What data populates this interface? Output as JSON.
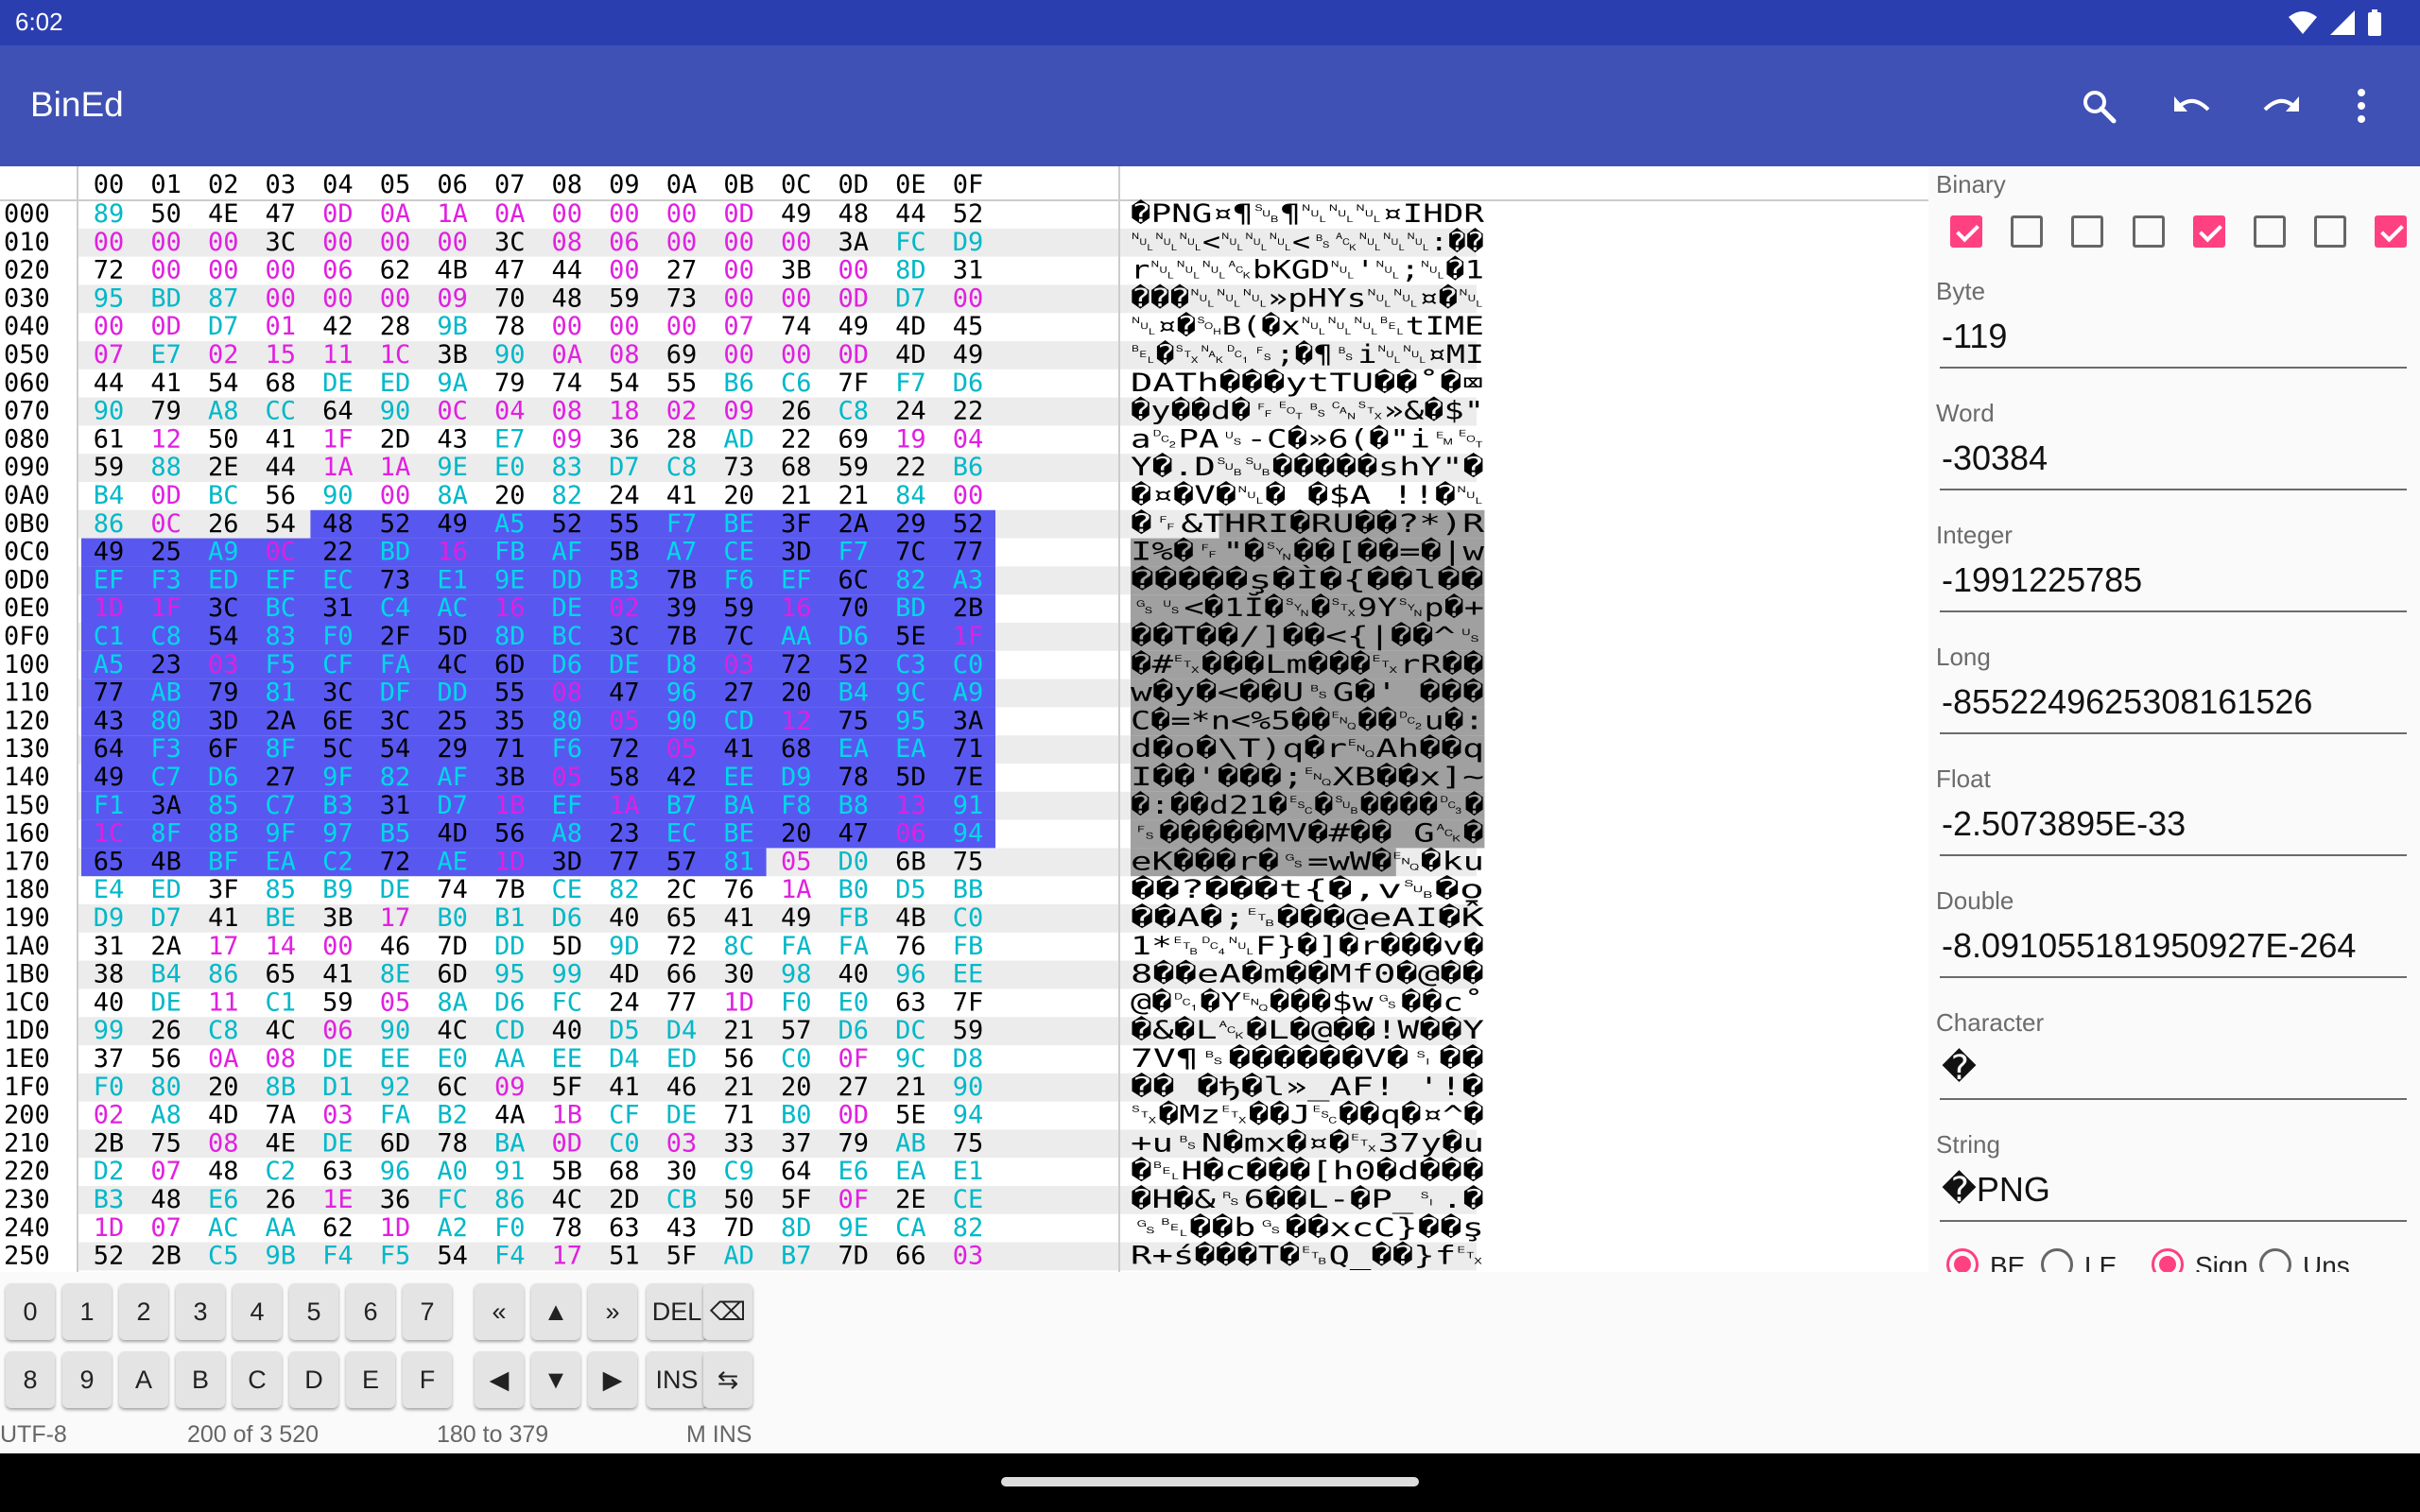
{
  "status_bar": {
    "time": "6:02"
  },
  "app_bar": {
    "title": "BinEd",
    "actions": [
      "search-icon",
      "undo-icon",
      "redo-icon",
      "more-vert-icon"
    ]
  },
  "hex_view": {
    "column_header": [
      "00",
      "01",
      "02",
      "03",
      "04",
      "05",
      "06",
      "07",
      "08",
      "09",
      "0A",
      "0B",
      "0C",
      "0D",
      "0E",
      "0F"
    ],
    "rows": [
      {
        "addr": "000",
        "hex": "89 50 4E 47 0D 0A 1A 0A 00 00 00 0D 49 48 44 52",
        "text": "�PNG¤¶␚¶␀␀␀¤IHDR"
      },
      {
        "addr": "010",
        "hex": "00 00 00 3C 00 00 00 3C 08 06 00 00 00 3A FC D9",
        "text": "␀␀␀<␀␀␀<␈␆␀␀␀:��"
      },
      {
        "addr": "020",
        "hex": "72 00 00 00 06 62 4B 47 44 00 27 00 3B 00 8D 31",
        "text": "r␀␀␀␆bKGD␀'␀;␀�1"
      },
      {
        "addr": "030",
        "hex": "95 BD 87 00 00 00 09 70 48 59 73 00 00 0D D7 00",
        "text": "���␀␀␀»pHYs␀␀¤�␀"
      },
      {
        "addr": "040",
        "hex": "00 0D D7 01 42 28 9B 78 00 00 00 07 74 49 4D 45",
        "text": "␀¤�␁B(�x␀␀␀␇tIME"
      },
      {
        "addr": "050",
        "hex": "07 E7 02 15 11 1C 3B 90 0A 08 69 00 00 0D 4D 49",
        "text": "␇�␂␕␑␜;�¶␈i␀␀¤MI"
      },
      {
        "addr": "060",
        "hex": "44 41 54 68 DE ED 9A 79 74 54 55 B6 C6 7F F7 D6",
        "text": "DATh���ytTU��˚�⌧"
      },
      {
        "addr": "070",
        "hex": "90 79 A8 CC 64 90 0C 04 08 18 02 09 26 C8 24 22",
        "text": "�y��d�␌␄␈␘␂»&�$\""
      },
      {
        "addr": "080",
        "hex": "61 12 50 41 1F 2D 43 E7 09 36 28 AD 22 69 19 04",
        "text": "a␒PA␟-C�»6(�\"i␙␄"
      },
      {
        "addr": "090",
        "hex": "59 88 2E 44 1A 1A 9E E0 83 D7 C8 73 68 59 22 B6",
        "text": "Y�.D␚␚�����shY\"�"
      },
      {
        "addr": "0A0",
        "hex": "B4 0D BC 56 90 00 8A 20 82 24 41 20 21 21 84 00",
        "text": "�¤�V�␀� �$A !!�␀"
      },
      {
        "addr": "0B0",
        "hex": "86 0C 26 54 48 52 49 A5 52 55 F7 BE 3F 2A 29 52",
        "text": "�␌&THRI�RU��?*)R"
      },
      {
        "addr": "0C0",
        "hex": "49 25 A9 0C 22 BD 16 FB AF 5B A7 CE 3D F7 7C 77",
        "text": "I%�␌\"�␖��[��=�|w"
      },
      {
        "addr": "0D0",
        "hex": "EF F3 ED EF EC 73 E1 9E DD B3 7B F6 EF 6C 82 A3",
        "text": "�����ş�Ì�{��l��"
      },
      {
        "addr": "0E0",
        "hex": "1D 1F 3C BC 31 C4 AC 16 DE 02 39 59 16 70 BD 2B",
        "text": "␝␟<�1Ĭ�␖�␂9Y␖p�+"
      },
      {
        "addr": "0F0",
        "hex": "C1 C8 54 83 F0 2F 5D 8D BC 3C 7B 7C AA D6 5E 1F",
        "text": "��T��/]��<{|��^␟"
      },
      {
        "addr": "100",
        "hex": "A5 23 03 F5 CF FA 4C 6D D6 DE D8 03 72 52 C3 C0",
        "text": "�#␃���Lm���␃rR��"
      },
      {
        "addr": "110",
        "hex": "77 AB 79 81 3C DF DD 55 08 47 96 27 20 B4 9C A9",
        "text": "w�y�<��U␈G�' ���"
      },
      {
        "addr": "120",
        "hex": "43 80 3D 2A 6E 3C 25 35 80 05 90 CD 12 75 95 3A",
        "text": "C�=*n<%5��␅��␒u�:"
      },
      {
        "addr": "130",
        "hex": "64 F3 6F 8F 5C 54 29 71 F6 72 05 41 68 EA EA 71",
        "text": "d�o�\\T)q�r␅Ah��q"
      },
      {
        "addr": "140",
        "hex": "49 C7 D6 27 9F 82 AF 3B 05 58 42 EE D9 78 5D 7E",
        "text": "I��'���;␅XB��x]~"
      },
      {
        "addr": "150",
        "hex": "F1 3A 85 C7 B3 31 D7 1B EF 1A B7 BA F8 B8 13 91",
        "text": "�:��d21�␛�␚����␓�"
      },
      {
        "addr": "160",
        "hex": "1C 8F 8B 9F 97 B5 4D 56 A8 23 EC BE 20 47 06 94",
        "text": "␜�����MV�#�� G␆�"
      },
      {
        "addr": "170",
        "hex": "65 4B BF EA C2 72 AE 1D 3D 77 57 81 05 D0 6B 75",
        "text": "eK���r�␝=wW�␅�ku"
      },
      {
        "addr": "180",
        "hex": "E4 ED 3F 85 B9 DE 74 7B CE 82 2C 76 1A B0 D5 BB",
        "text": "��?���t{�,v␚�o̱"
      },
      {
        "addr": "190",
        "hex": "D9 D7 41 BE 3B 17 B0 B1 D6 40 65 41 49 FB 4B C0",
        "text": "��A�;␗���@eAI�K̂"
      },
      {
        "addr": "1A0",
        "hex": "31 2A 17 14 00 46 7D DD 5D 9D 72 8C FA FA 76 FB",
        "text": "1*␗␔␀F}�]�r���v�"
      },
      {
        "addr": "1B0",
        "hex": "38 B4 86 65 41 8E 6D 95 99 4D 66 30 98 40 96 EE",
        "text": "8��eA�m��Mf0�@��"
      },
      {
        "addr": "1C0",
        "hex": "40 DE 11 C1 59 05 8A D6 FC 24 77 1D F0 E0 63 7F",
        "text": "@�␑�Y␅���$w␝��c˚"
      },
      {
        "addr": "1D0",
        "hex": "99 26 C8 4C 06 90 4C CD 40 D5 D4 21 57 D6 DC 59",
        "text": "�&�L␆�L�@��!W��Y"
      },
      {
        "addr": "1E0",
        "hex": "37 56 0A 08 DE EE E0 AA EE D4 ED 56 C0 0F 9C D8",
        "text": "7V¶␈������V�␏��"
      },
      {
        "addr": "1F0",
        "hex": "F0 80 20 8B D1 92 6C 09 5F 41 46 21 20 27 21 90",
        "text": "�� �ђ�l»_AF! '!�"
      },
      {
        "addr": "200",
        "hex": "02 A8 4D 7A 03 FA B2 4A 1B CF DE 71 B0 0D 5E 94",
        "text": "␂�Mz␃��J␛��q�¤^�"
      },
      {
        "addr": "210",
        "hex": "2B 75 08 4E DE 6D 78 BA 0D C0 03 33 37 79 AB 75",
        "text": "+u␈N�mx�¤�␃37y�u"
      },
      {
        "addr": "220",
        "hex": "D2 07 48 C2 63 96 A0 91 5B 68 30 C9 64 E6 EA E1",
        "text": "�␇H�c���[h0�d���"
      },
      {
        "addr": "230",
        "hex": "B3 48 E6 26 1E 36 FC 86 4C 2D CB 50 5F 0F 2E CE",
        "text": "�H�&␞6��L-�P_␏.�"
      },
      {
        "addr": "240",
        "hex": "1D 07 AC AA 62 1D A2 F0 78 63 43 7D 8D 9E CA 82",
        "text": "␝␇��b␝��xcC}��ş"
      },
      {
        "addr": "250",
        "hex": "52 2B C5 9B F4 F5 54 F4 17 51 5F AD B7 7D 66 03",
        "text": "R+ś���T�␗Q_��}f␃"
      }
    ]
  },
  "values_panel": {
    "binary_label": "Binary",
    "binary_bits": [
      true,
      false,
      false,
      false,
      true,
      false,
      false,
      true
    ],
    "fields": [
      {
        "label": "Byte",
        "value": "-119"
      },
      {
        "label": "Word",
        "value": "-30384"
      },
      {
        "label": "Integer",
        "value": "-1991225785"
      },
      {
        "label": "Long",
        "value": "-8552249625308161526"
      },
      {
        "label": "Float",
        "value": "-2.5073895E-33"
      },
      {
        "label": "Double",
        "value": "-8.091055181950927E-264"
      },
      {
        "label": "Character",
        "value": "�"
      },
      {
        "label": "String",
        "value": "�PNG"
      }
    ],
    "radios": [
      {
        "label": "BE",
        "checked": true
      },
      {
        "label": "LE",
        "checked": false
      },
      {
        "label": "Sign",
        "checked": true
      },
      {
        "label": "Uns",
        "checked": false
      }
    ]
  },
  "keypad": {
    "row1": [
      "0",
      "1",
      "2",
      "3",
      "4",
      "5",
      "6",
      "7",
      "«",
      "▲",
      "»",
      "DEL",
      "⌫"
    ],
    "row2": [
      "8",
      "9",
      "A",
      "B",
      "C",
      "D",
      "E",
      "F",
      "◀",
      "▼",
      "▶",
      "INS",
      "⇆"
    ]
  },
  "status_line": {
    "encoding": "UTF-8",
    "position": "200 of 3 520",
    "selection": "180 to 379",
    "mode": "M INS"
  },
  "colors": {
    "app_bar": "#3f51b5",
    "status_bar": "#2b3eb0",
    "selection_hex": "#5858f0",
    "selection_text": "#a0a0a0",
    "accent": "#ff4081",
    "hex_black": "#000000",
    "hex_cyan": "#00b8c8",
    "hex_magenta": "#e020e0"
  }
}
